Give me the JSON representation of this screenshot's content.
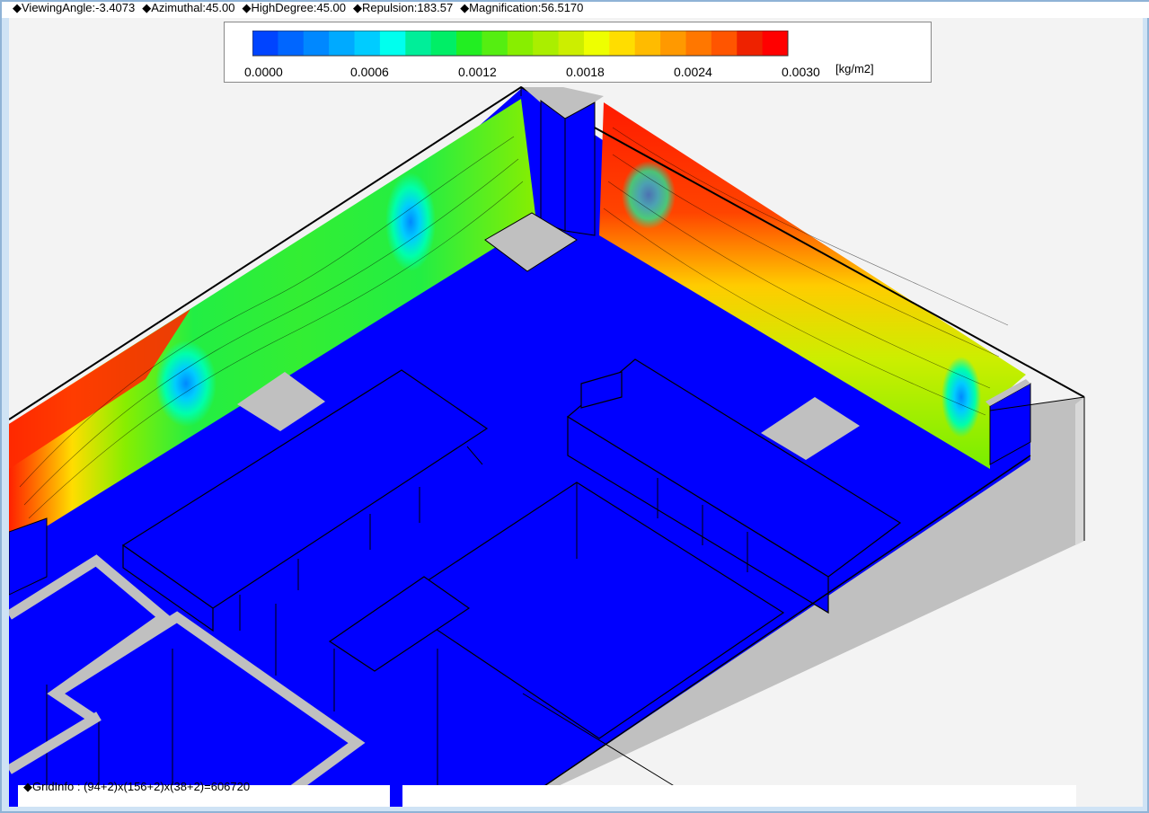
{
  "status_bar": {
    "viewing_angle": "◆ViewingAngle:-3.4073",
    "azimuthal": "◆Azimuthal:45.00",
    "high_degree": "◆HighDegree:45.00",
    "repulsion": "◆Repulsion:183.57",
    "magnification": "◆Magnification:56.5170"
  },
  "legend": {
    "ticks": [
      "0.0000",
      "0.0006",
      "0.0012",
      "0.0018",
      "0.0024",
      "0.0030"
    ],
    "unit": "[kg/m2]",
    "colors": [
      "#0044ff",
      "#0066ff",
      "#0088ff",
      "#00aaff",
      "#00ccff",
      "#00ffee",
      "#00ee99",
      "#00ee66",
      "#22ee22",
      "#55ee11",
      "#88ee00",
      "#aaee00",
      "#ccee00",
      "#eeff00",
      "#ffdd00",
      "#ffbb00",
      "#ff9900",
      "#ff7700",
      "#ff5500",
      "#ee2200",
      "#ff0000"
    ]
  },
  "grid_info": "◆GridInfo : (94+2)x(156+2)x(38+2)=606720",
  "scene_colors": {
    "floor": "#0000ff",
    "wall_gray": "#c0c0c0",
    "background": "#f3f3f3"
  }
}
